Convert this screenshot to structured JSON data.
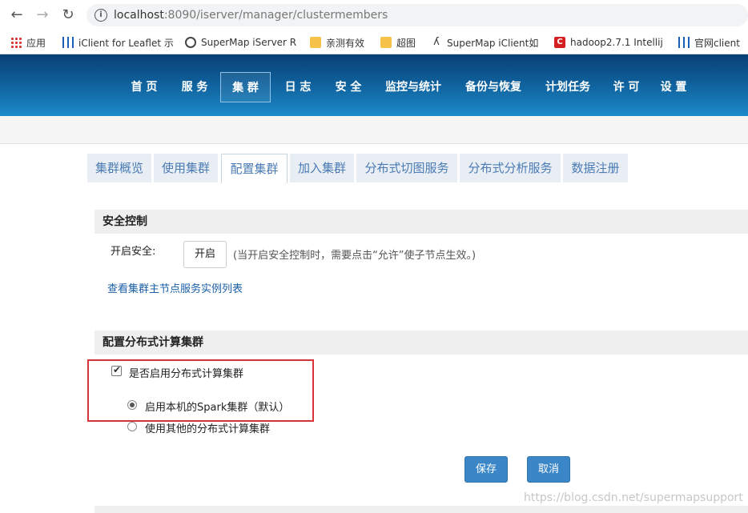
{
  "browser": {
    "url_host": "localhost",
    "url_rest": ":8090/iserver/manager/clustermembers",
    "bookmarks": [
      "应用",
      "iClient for Leaflet 示",
      "SuperMap iServer R",
      "亲测有效",
      "超图",
      "SuperMap iClient如",
      "hadoop2.7.1 Intellij",
      "官网client"
    ]
  },
  "topnav": {
    "items": [
      "首 页",
      "服 务",
      "集 群",
      "日 志",
      "安 全",
      "监控与统计",
      "备份与恢复",
      "计划任务",
      "许 可",
      "设 置"
    ],
    "active_index": 2
  },
  "tabs": {
    "items": [
      "集群概览",
      "使用集群",
      "配置集群",
      "加入集群",
      "分布式切图服务",
      "分布式分析服务",
      "数据注册"
    ],
    "active_index": 2
  },
  "security": {
    "title": "安全控制",
    "enable_label": "开启安全:",
    "enable_button": "开启",
    "hint": "(当开启安全控制时，需要点击“允许”使子节点生效。)",
    "link": "查看集群主节点服务实例列表"
  },
  "distributed": {
    "title": "配置分布式计算集群",
    "checkbox_label": "是否启用分布式计算集群",
    "checkbox_checked": true,
    "radio_local": "启用本机的Spark集群（默认）",
    "radio_other": "使用其他的分布式计算集群",
    "selected": "local"
  },
  "actions": {
    "save": "保存",
    "cancel": "取消"
  },
  "watermark": "https://blog.csdn.net/supermapsupport",
  "colors": {
    "nav_top": "#0a3f74",
    "nav_bottom": "#1b8ac8",
    "primary": "#3b86c6",
    "highlight_box": "#d9333a"
  }
}
